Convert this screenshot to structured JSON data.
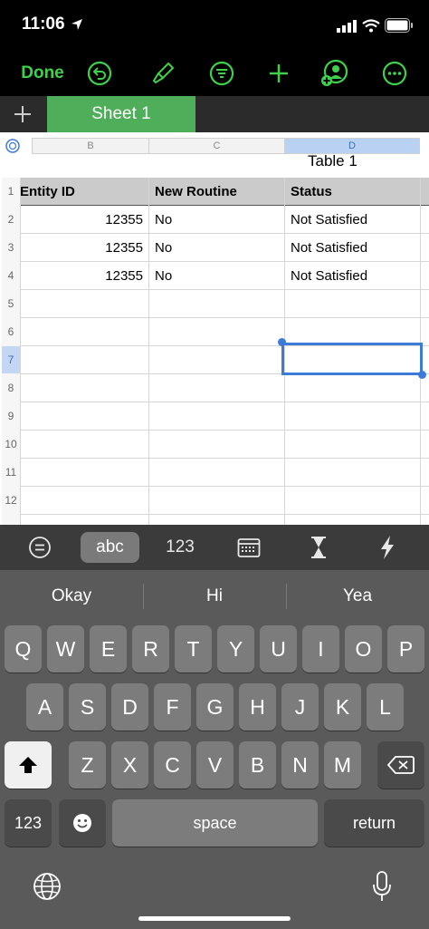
{
  "status_bar": {
    "time": "11:06"
  },
  "toolbar": {
    "done_label": "Done"
  },
  "tabs": {
    "sheet_label": "Sheet 1"
  },
  "columns": [
    "B",
    "C",
    "D"
  ],
  "table": {
    "title": "Table 1",
    "headers": [
      "Entity ID",
      "New Routine",
      "Status"
    ],
    "rows": [
      [
        "12355",
        "No",
        "Not Satisfied"
      ],
      [
        "12355",
        "No",
        "Not Satisfied"
      ],
      [
        "12355",
        "No",
        "Not Satisfied"
      ]
    ]
  },
  "row_numbers": [
    "1",
    "2",
    "3",
    "4",
    "5",
    "6",
    "7",
    "8",
    "9",
    "10",
    "11",
    "12"
  ],
  "keyboard_toolbar": {
    "abc": "abc",
    "numbers": "123"
  },
  "suggestions": [
    "Okay",
    "Hi",
    "Yea"
  ],
  "keyboard": {
    "row1": [
      "Q",
      "W",
      "E",
      "R",
      "T",
      "Y",
      "U",
      "I",
      "O",
      "P"
    ],
    "row2": [
      "A",
      "S",
      "D",
      "F",
      "G",
      "H",
      "J",
      "K",
      "L"
    ],
    "row3": [
      "Z",
      "X",
      "C",
      "V",
      "B",
      "N",
      "M"
    ],
    "numbers_key": "123",
    "space_key": "space",
    "return_key": "return"
  },
  "accent_color": "#3fd14a",
  "tab_color": "#4fae5a",
  "selection_color": "#3d7bd9"
}
